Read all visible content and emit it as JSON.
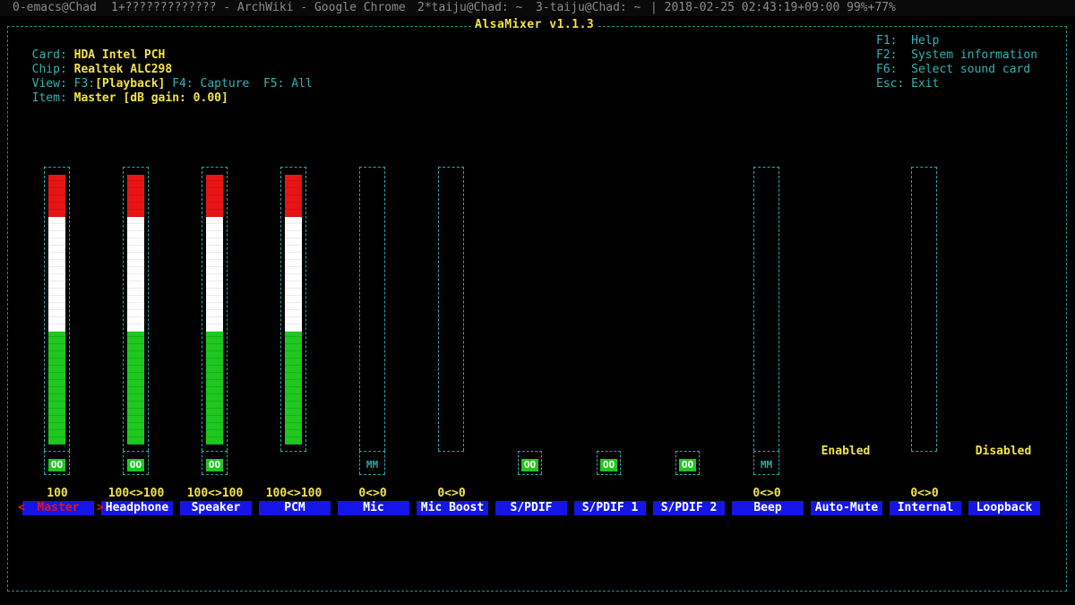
{
  "topbar": {
    "win0": "0-emacs@Chad",
    "win1": "1+????????????? - ArchWiki - Google Chrome",
    "win2": "2*taiju@Chad: ~",
    "win3": "3-taiju@Chad: ~",
    "status": "| 2018-02-25 02:43:19+09:00 99%+77%"
  },
  "app": {
    "title": "AlsaMixer v1.1.3"
  },
  "info": {
    "card_label": "Card:",
    "card_value": "HDA Intel PCH",
    "chip_label": "Chip:",
    "chip_value": "Realtek ALC298",
    "view_label": "View:",
    "view_f3": "F3:",
    "view_playback": "[Playback]",
    "view_f4": "F4: Capture",
    "view_f5": "F5: All",
    "item_label": "Item:",
    "item_value": "Master [dB gain: 0.00]"
  },
  "help": [
    {
      "key": "F1:",
      "text": "Help"
    },
    {
      "key": "F2:",
      "text": "System information"
    },
    {
      "key": "F6:",
      "text": "Select sound card"
    },
    {
      "key": "Esc:",
      "text": "Exit"
    }
  ],
  "colors": {
    "background": "#000000",
    "frame": "#2aa7a7",
    "highlight": "#f2e24a",
    "label_bg": "#1515e8",
    "bar_red": "#e81414",
    "bar_white": "#ffffff",
    "bar_green": "#1ec81e"
  },
  "controls": [
    {
      "name": "Master",
      "level": "100",
      "switch": "OO",
      "switch_on": true,
      "volume": 1.0,
      "selected": true
    },
    {
      "name": "Headphone",
      "level": "100<>100",
      "switch": "OO",
      "switch_on": true,
      "volume": 1.0
    },
    {
      "name": "Speaker",
      "level": "100<>100",
      "switch": "OO",
      "switch_on": true,
      "volume": 1.0
    },
    {
      "name": "PCM",
      "level": "100<>100",
      "switch": "",
      "switch_on": false,
      "volume": 1.0
    },
    {
      "name": "Mic",
      "level": "0<>0",
      "switch": "MM",
      "switch_on": false,
      "volume": 0
    },
    {
      "name": "Mic Boost",
      "level": "0<>0",
      "switch": "",
      "switch_on": false,
      "volume": 0
    },
    {
      "name": "S/PDIF",
      "level": "",
      "switch": "OO",
      "switch_on": true
    },
    {
      "name": "S/PDIF 1",
      "level": "",
      "switch": "OO",
      "switch_on": true
    },
    {
      "name": "S/PDIF 2",
      "level": "",
      "switch": "OO",
      "switch_on": true
    },
    {
      "name": "Beep",
      "level": "0<>0",
      "switch": "MM",
      "switch_on": false,
      "volume": 0
    },
    {
      "name": "Auto-Mute",
      "level": "",
      "state": "Enabled"
    },
    {
      "name": "Internal",
      "level": "0<>0",
      "switch": "",
      "switch_on": false,
      "volume": 0
    },
    {
      "name": "Loopback",
      "level": "",
      "state": "Disabled"
    }
  ],
  "selection": {
    "left_arrow": "<",
    "right_arrow": ">"
  }
}
